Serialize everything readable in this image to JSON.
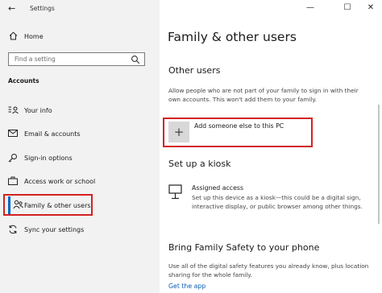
{
  "window": {
    "title": "Settings",
    "back_glyph": "←",
    "minimize_glyph": "—",
    "maximize_glyph": "☐",
    "close_glyph": "✕"
  },
  "sidebar": {
    "home": {
      "label": "Home",
      "icon": "home-icon"
    },
    "search": {
      "placeholder": "Find a setting",
      "icon": "search-icon"
    },
    "section_title": "Accounts",
    "items": [
      {
        "label": "Your info",
        "icon": "person-card-icon"
      },
      {
        "label": "Email & accounts",
        "icon": "email-icon"
      },
      {
        "label": "Sign-in options",
        "icon": "key-icon"
      },
      {
        "label": "Access work or school",
        "icon": "briefcase-icon"
      },
      {
        "label": "Family & other users",
        "icon": "people-icon",
        "selected": true
      },
      {
        "label": "Sync your settings",
        "icon": "sync-icon"
      }
    ]
  },
  "main": {
    "title": "Family & other users",
    "other_users": {
      "heading": "Other users",
      "description": "Allow people who are not part of your family to sign in with their own accounts. This won't add them to your family.",
      "add_label": "Add someone else to this PC",
      "add_glyph": "+"
    },
    "kiosk": {
      "heading": "Set up a kiosk",
      "item_title": "Assigned access",
      "item_description": "Set up this device as a kiosk—this could be a digital sign, interactive display, or public browser among other things."
    },
    "family_safety": {
      "heading": "Bring Family Safety to your phone",
      "description": "Use all of the digital safety features you already know, plus location sharing for the whole family.",
      "link": "Get the app"
    }
  },
  "colors": {
    "accent": "#0067c0",
    "highlight_box": "#d32121",
    "sidebar_bg": "#f2f2f2"
  }
}
